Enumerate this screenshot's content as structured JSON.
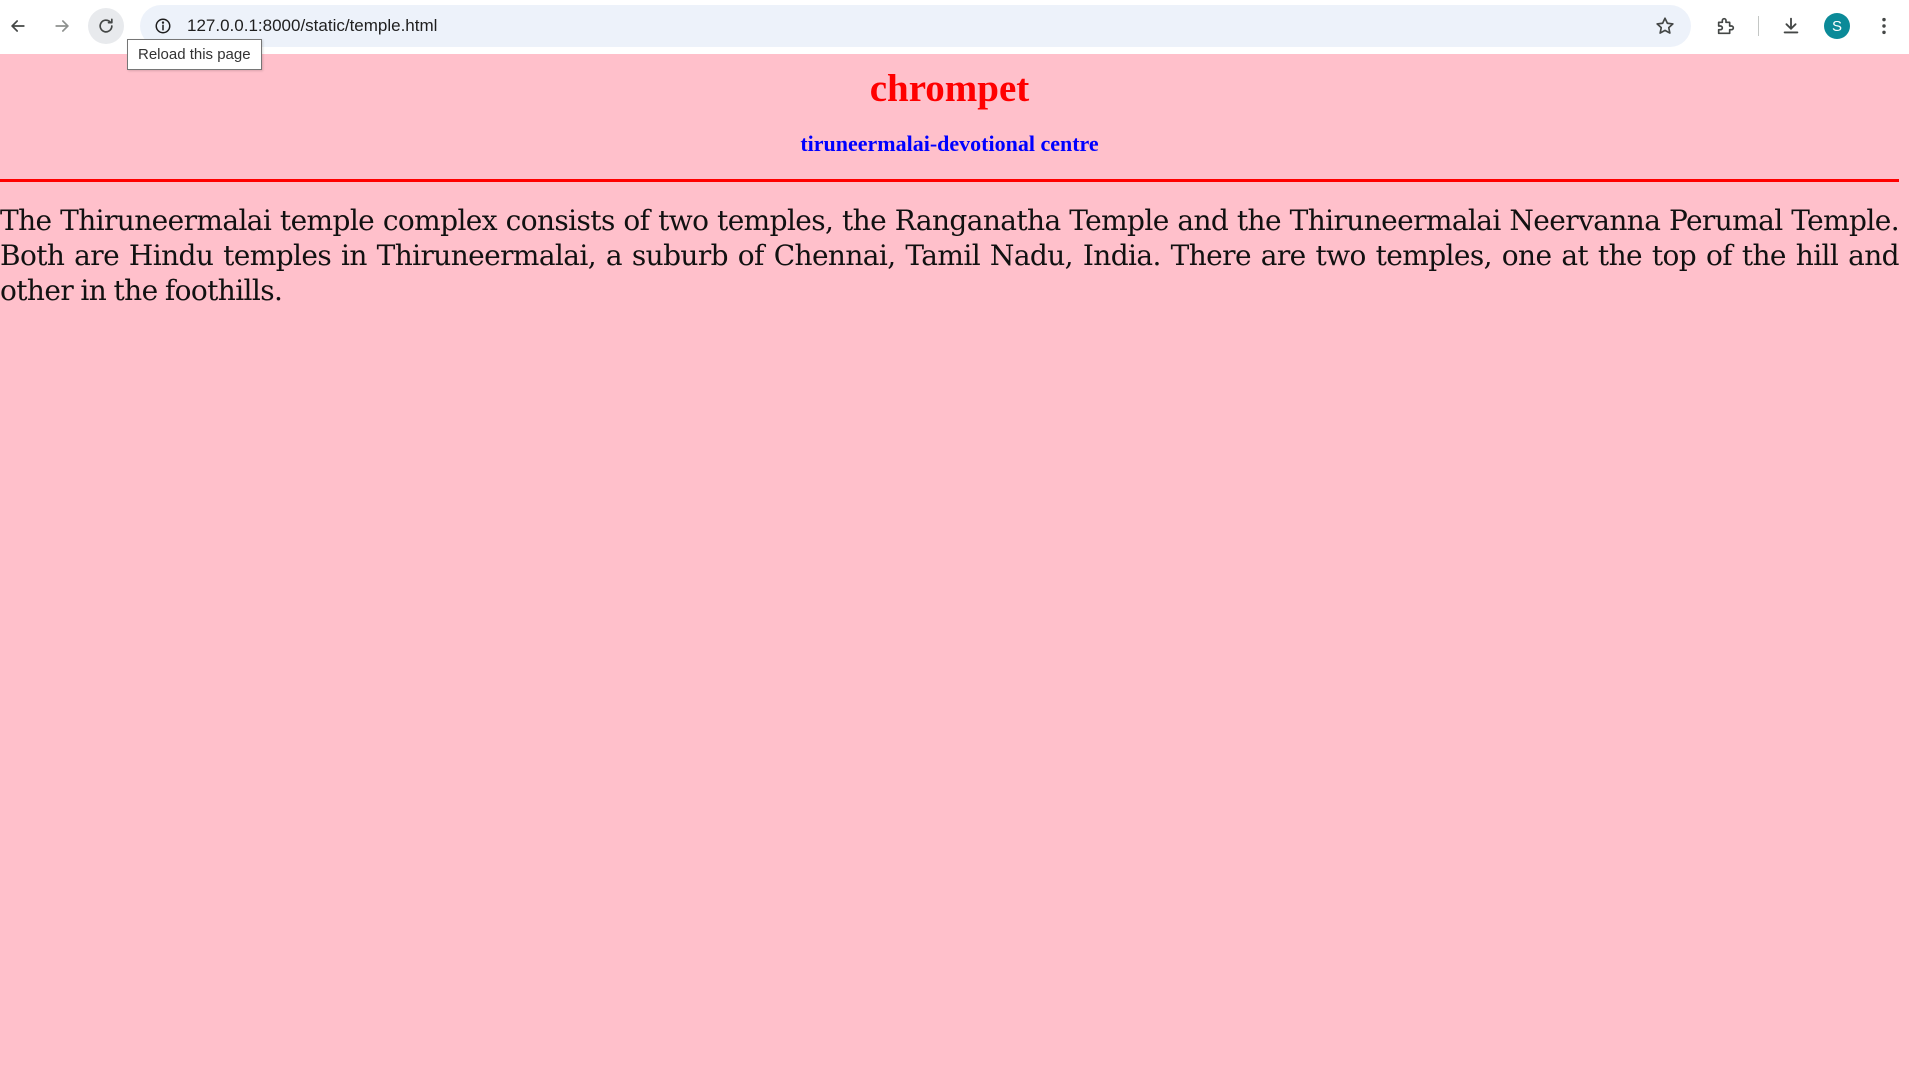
{
  "browser": {
    "url": "127.0.0.1:8000/static/temple.html",
    "tooltip": "Reload this page",
    "profile_initial": "S",
    "icons": {
      "back": "arrow-left-icon",
      "forward": "arrow-right-icon",
      "reload": "reload-icon",
      "site_info": "info-icon",
      "bookmark": "star-icon",
      "extensions": "puzzle-icon",
      "downloads": "download-icon",
      "menu": "kebab-menu-icon"
    },
    "colors": {
      "omnibox_bg": "#edf2fa",
      "avatar_bg": "#0b8a98"
    }
  },
  "page": {
    "title": "chrompet",
    "subtitle": "tiruneermalai-devotional centre",
    "paragraph": "The Thiruneermalai temple complex consists of two temples, the Ranganatha Temple and the Thiruneermalai Neervanna Perumal Temple. Both are Hindu temples in Thiruneermalai, a suburb of Chennai, Tamil Nadu, India. There are two temples, one at the top of the hill and other in the foothills.",
    "colors": {
      "background": "#ffc0cb",
      "title": "#ff0000",
      "subtitle": "#0000ff",
      "divider": "#ff0000"
    }
  }
}
